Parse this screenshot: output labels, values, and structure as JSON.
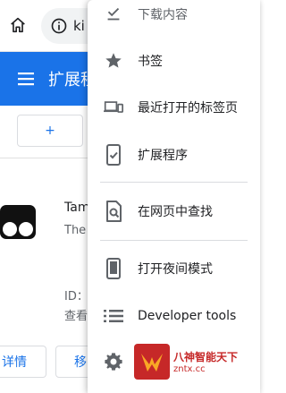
{
  "toolbar": {
    "url_text": "ki"
  },
  "appbar": {
    "title": "扩展程序"
  },
  "page": {
    "add_label": "+",
    "extension": {
      "name": "Tam",
      "description": "The",
      "id_label": "ID：",
      "view_label": "查看"
    },
    "details_label": "详情",
    "remove_label": "移"
  },
  "menu": {
    "items": [
      {
        "label": "下载内容",
        "icon": "download-check-icon"
      },
      {
        "label": "书签",
        "icon": "star-icon"
      },
      {
        "label": "最近打开的标签页",
        "icon": "devices-icon"
      },
      {
        "label": "扩展程序",
        "icon": "extension-phone-icon"
      },
      {
        "label": "在网页中查找",
        "icon": "find-in-page-icon"
      },
      {
        "label": "打开夜间模式",
        "icon": "phone-icon"
      },
      {
        "label": "Developer tools",
        "icon": "list-icon"
      },
      {
        "label": "",
        "icon": "gear-icon"
      }
    ]
  },
  "watermark": {
    "line1": "八神智能天下",
    "line2": "zntx.cc"
  },
  "colors": {
    "accent": "#1a73e8",
    "icon": "#5f6368",
    "divider": "#dadce0"
  }
}
